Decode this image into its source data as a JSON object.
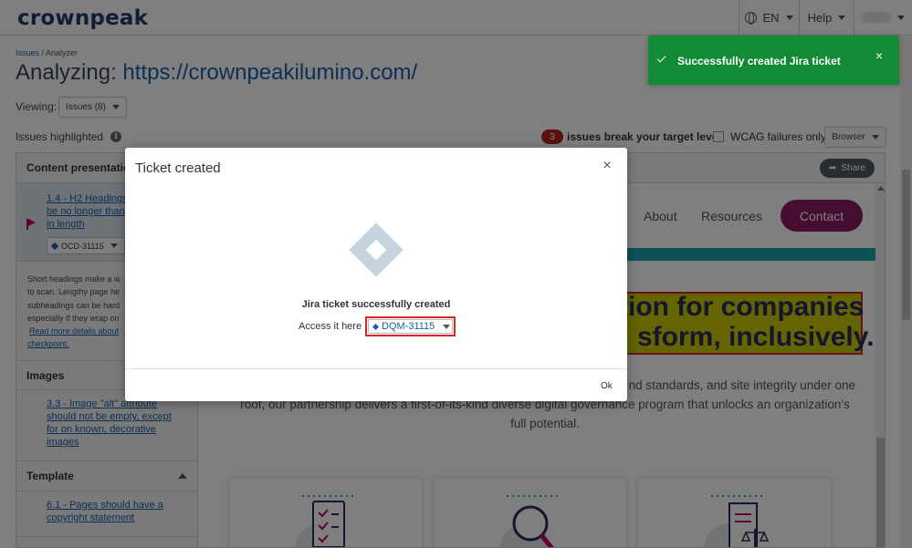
{
  "topnav": {
    "logo": "crownpeak",
    "language": "EN",
    "help": "Help"
  },
  "breadcrumb": {
    "parent": "Issues",
    "separator": " / ",
    "current": "Analyzer"
  },
  "page": {
    "title_prefix": "Analyzing: ",
    "url": "https://crownpeakilumino.com/",
    "viewing_label": "Viewing:",
    "viewing_value": "Issues (8)",
    "issues_highlighted": "Issues highlighted",
    "info_icon": "i",
    "break_count": "3",
    "break_text": "issues break your target level",
    "wcag_label": "WCAG failures only",
    "browser_select": "Browser"
  },
  "sidebar": {
    "section1": "Content presentation",
    "issue1_line1": "1.4 - H2 Headings",
    "issue1_line2": "be no longer than",
    "issue1_line3": "in length",
    "issue1_ticket": "OCD-31115",
    "desc_line1": "Short headings make a w",
    "desc_line2": "to scan. Lengthy page he",
    "desc_line3": "subheadings can be hard",
    "desc_line4": "especially if they wrap on",
    "desc_link1": "Read more details about",
    "desc_link2": "checkpoint.",
    "section2": "Images",
    "issue2_line1": "3.3 - Image \"alt\" attribute",
    "issue2_line2": "should not be empty, except",
    "issue2_line3": "for on known, decorative",
    "issue2_line4": "images",
    "section3": "Template",
    "issue3_line1": "6.1 - Pages should have a",
    "issue3_line2": "copyright statement"
  },
  "preview": {
    "share": "Share",
    "nav_about": "About",
    "nav_resources": "Resources",
    "nav_contact": "Contact",
    "hero_line1": "tion for companies",
    "hero_line2": "sform, inclusively.",
    "para_line1": "nd standards, and site integrity under one",
    "para_line2": "roof, our partnership delivers a first-of-its-kind diverse digital governance program that unlocks an organization's",
    "para_line3": "full potential."
  },
  "modal": {
    "title": "Ticket created",
    "close": "×",
    "success": "Jira ticket successfully created",
    "access_label": "Access it here",
    "ticket": "DQM-31115",
    "ok": "Ok"
  },
  "toast": {
    "text": "Successfully created Jira ticket",
    "close": "×"
  },
  "colors": {
    "brand_navy": "#233b6e",
    "brand_magenta": "#c4006a",
    "link_blue": "#1a5fa8",
    "toast_green": "#138a36",
    "contact_purple": "#8b1a5e",
    "teal": "#1ba3ad",
    "error_red": "#d9262b"
  }
}
